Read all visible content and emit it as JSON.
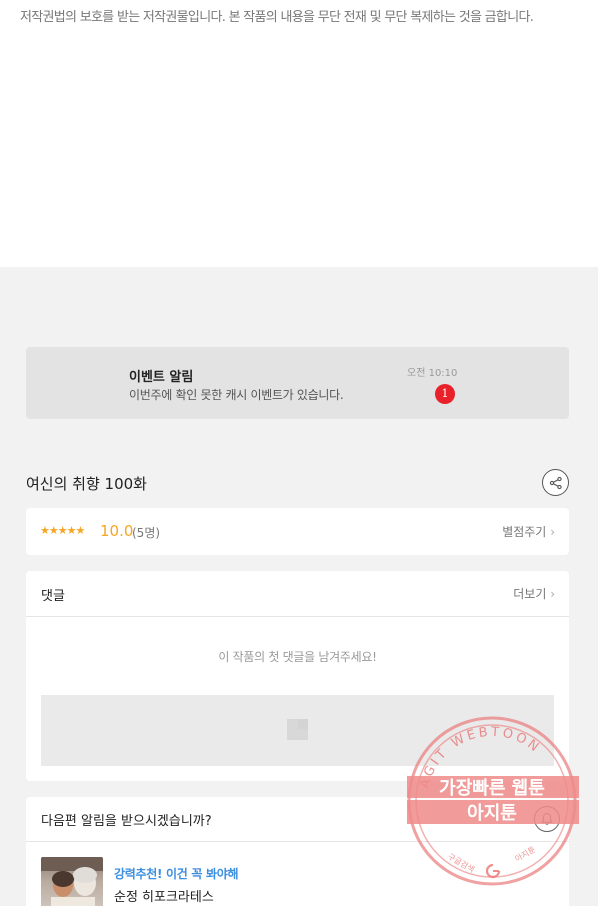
{
  "copyright_notice": "저작권법의 보호를 받는 저작권물입니다. 본 작품의 내용을 무단 전재 및 무단 복제하는 것을 금합니다.",
  "event": {
    "title": "이벤트 알림",
    "description": "이번주에 확인 못한 캐시 이벤트가 있습니다.",
    "time": "오전 10:10",
    "badge_count": "1"
  },
  "episode": {
    "title": "여신의 취향 100화"
  },
  "rating": {
    "stars": "★★★★★",
    "score": "10.0",
    "count": "(5명)",
    "rate_link": "별점주기"
  },
  "comments": {
    "title": "댓글",
    "more_link": "더보기",
    "empty_message": "이 작품의 첫 댓글을 남겨주세요!"
  },
  "notify": {
    "title": "다음편 알림을 받으시겠습니까?"
  },
  "recommendation": {
    "tag": "강력추천! 이건 꼭 봐야해",
    "name": "순정 히포크라테스"
  },
  "watermark": {
    "arc_text": "AGIT WEBTOON",
    "line1": "가장빠른 웹툰",
    "line2": "아지툰",
    "bottom_left": "구글검색",
    "bottom_right": "아지툰"
  },
  "colors": {
    "accent_orange": "#f5a623",
    "badge_red": "#e8212b",
    "link_blue": "#3b8ee0",
    "watermark_red": "#e87070"
  }
}
